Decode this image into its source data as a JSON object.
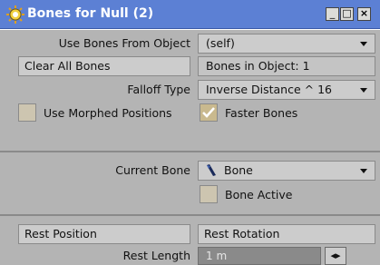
{
  "window": {
    "title": "Bones for Null (2)",
    "minimize_glyph": "_",
    "maximize_glyph": "□",
    "close_glyph": "×",
    "titlebar_color": "#5c80d4"
  },
  "bones_from": {
    "label": "Use Bones From Object",
    "value": "(self)"
  },
  "clear_all": {
    "label": "Clear All Bones"
  },
  "bones_in_object": {
    "text": "Bones in Object: 1"
  },
  "falloff": {
    "label": "Falloff Type",
    "value": "Inverse Distance ^ 16"
  },
  "morphed": {
    "label": "Use Morphed Positions",
    "checked": false
  },
  "faster": {
    "label": "Faster Bones",
    "checked": true
  },
  "current_bone": {
    "label": "Current Bone",
    "value": "Bone",
    "icon": "bone-icon"
  },
  "bone_active": {
    "label": "Bone Active",
    "checked": false
  },
  "rest_position": {
    "label": "Rest Position"
  },
  "rest_rotation": {
    "label": "Rest Rotation"
  },
  "rest_length": {
    "label": "Rest Length",
    "value": "1 m",
    "stepper_glyph": "◂▸"
  }
}
